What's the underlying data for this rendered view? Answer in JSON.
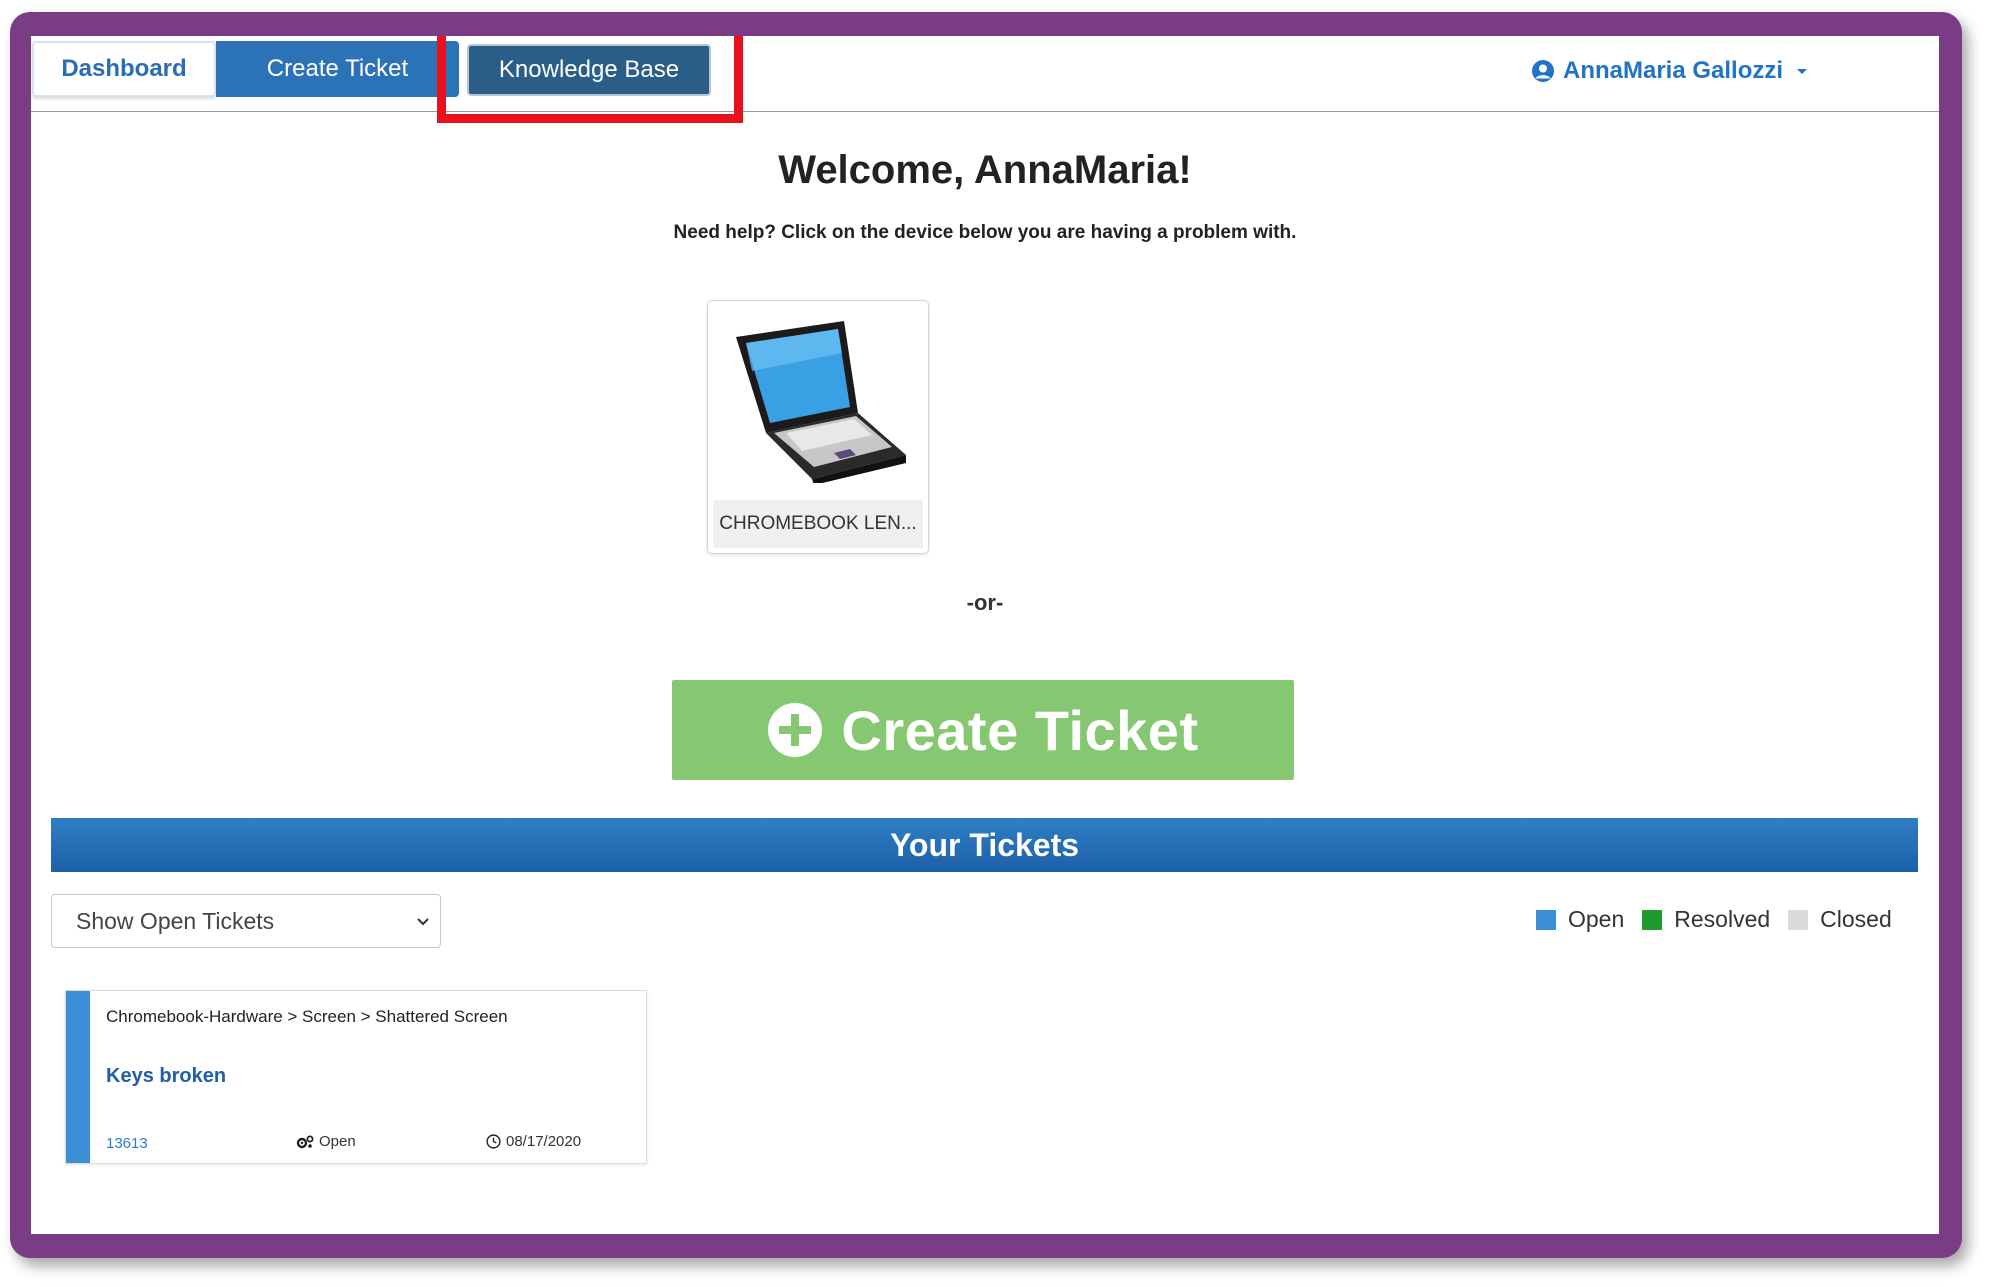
{
  "nav": {
    "tabs": [
      {
        "label": "Dashboard"
      },
      {
        "label": "Create Ticket"
      },
      {
        "label": "Knowledge Base"
      }
    ],
    "user_name": "AnnaMaria Gallozzi"
  },
  "welcome": {
    "title": "Welcome, AnnaMaria!",
    "help_text": "Need help? Click on the device below you are having a problem with."
  },
  "device": {
    "label": "CHROMEBOOK LEN...",
    "icon": "laptop-icon"
  },
  "or_text": "-or-",
  "create_button": {
    "label": "Create Ticket",
    "icon": "plus-circle-icon"
  },
  "tickets": {
    "heading": "Your Tickets",
    "filter": {
      "selected": "Show Open Tickets"
    },
    "legend": [
      {
        "label": "Open",
        "color": "#3a8fd7"
      },
      {
        "label": "Resolved",
        "color": "#1e9a2c"
      },
      {
        "label": "Closed",
        "color": "#dadada"
      }
    ],
    "items": [
      {
        "path": "Chromebook-Hardware > Screen > Shattered Screen",
        "title": "Keys broken",
        "id": "13613",
        "status": "Open",
        "date": "08/17/2020"
      }
    ]
  },
  "colors": {
    "frame": "#7a3d85",
    "highlight": "#e8121c",
    "primary": "#2c72b6",
    "create_green": "#86c872"
  }
}
